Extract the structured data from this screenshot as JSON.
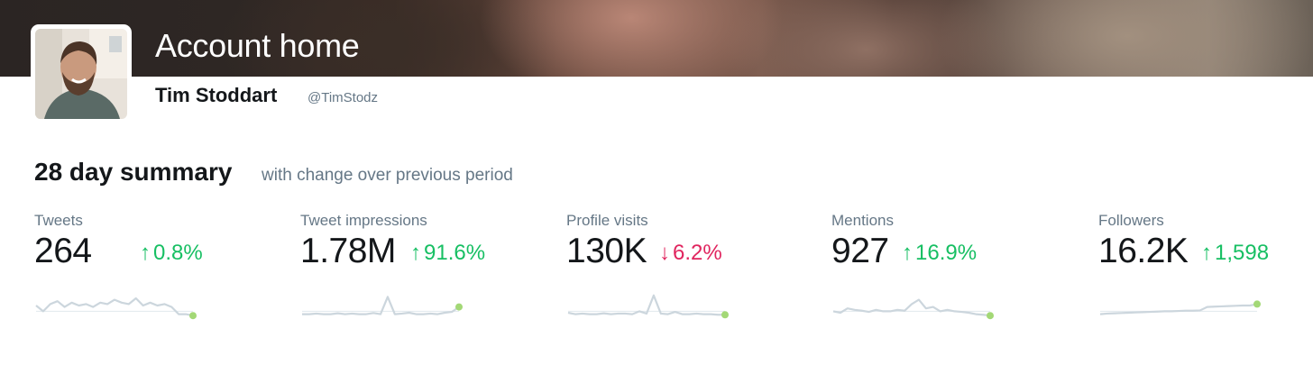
{
  "header": {
    "title": "Account home",
    "name": "Tim Stoddart",
    "handle": "@TimStodz"
  },
  "summary": {
    "title": "28 day summary",
    "subtitle": "with change over previous period"
  },
  "colors": {
    "up": "#17bf63",
    "down": "#e0245e",
    "sparkline": "#ccd6dd",
    "endpoint": "#a3d876"
  },
  "stats": [
    {
      "label": "Tweets",
      "value": "264",
      "change": "0.8%",
      "direction": "up",
      "trend": [
        0.5,
        0.3,
        0.55,
        0.65,
        0.45,
        0.6,
        0.5,
        0.55,
        0.45,
        0.6,
        0.55,
        0.7,
        0.6,
        0.55,
        0.75,
        0.5,
        0.6,
        0.5,
        0.55,
        0.45,
        0.2,
        0.2,
        0.15
      ]
    },
    {
      "label": "Tweet impressions",
      "value": "1.78M",
      "change": "91.6%",
      "direction": "up",
      "trend": [
        0.2,
        0.2,
        0.22,
        0.2,
        0.2,
        0.23,
        0.2,
        0.22,
        0.2,
        0.2,
        0.24,
        0.2,
        0.8,
        0.2,
        0.22,
        0.25,
        0.2,
        0.2,
        0.22,
        0.2,
        0.25,
        0.28,
        0.45
      ]
    },
    {
      "label": "Profile visits",
      "value": "130K",
      "change": "6.2%",
      "direction": "down",
      "trend": [
        0.25,
        0.2,
        0.22,
        0.2,
        0.2,
        0.23,
        0.2,
        0.22,
        0.22,
        0.2,
        0.3,
        0.22,
        0.85,
        0.22,
        0.2,
        0.28,
        0.2,
        0.2,
        0.22,
        0.2,
        0.2,
        0.18,
        0.18
      ]
    },
    {
      "label": "Mentions",
      "value": "927",
      "change": "16.9%",
      "direction": "up",
      "trend": [
        0.3,
        0.25,
        0.4,
        0.35,
        0.32,
        0.28,
        0.35,
        0.3,
        0.3,
        0.35,
        0.32,
        0.55,
        0.7,
        0.4,
        0.45,
        0.3,
        0.35,
        0.3,
        0.28,
        0.25,
        0.2,
        0.18,
        0.15
      ]
    },
    {
      "label": "Followers",
      "value": "16.2K",
      "change": "1,598",
      "direction": "up",
      "trend": [
        0.2,
        0.22,
        0.23,
        0.24,
        0.25,
        0.26,
        0.27,
        0.28,
        0.29,
        0.3,
        0.3,
        0.31,
        0.32,
        0.32,
        0.33,
        0.45,
        0.46,
        0.47,
        0.48,
        0.49,
        0.5,
        0.5,
        0.55
      ]
    }
  ]
}
